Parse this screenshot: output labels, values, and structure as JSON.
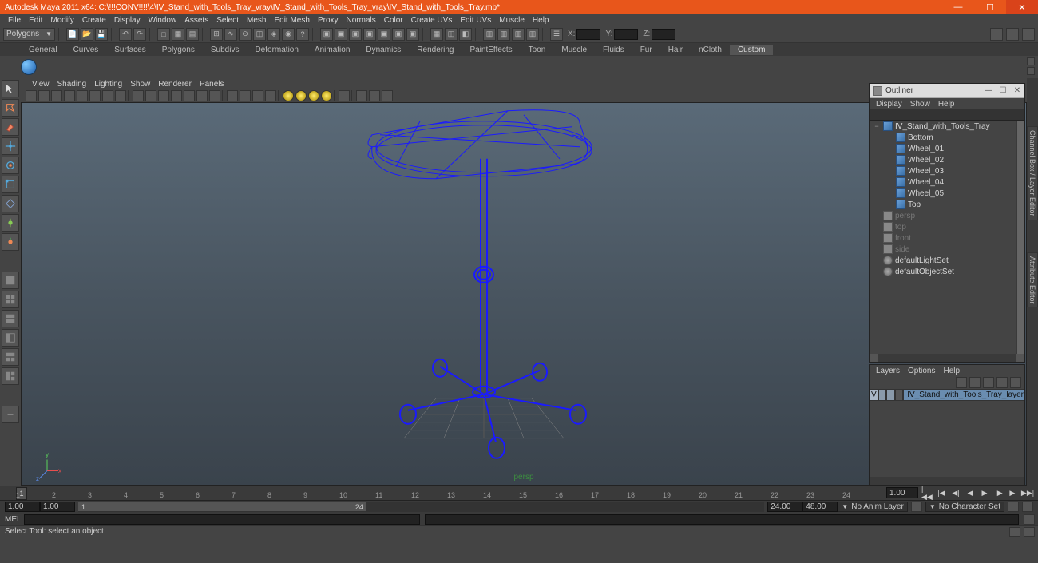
{
  "titlebar": {
    "app": "Autodesk Maya 2011 x64: ",
    "path": "C:\\!!!CONV!!!!\\4\\IV_Stand_with_Tools_Tray_vray\\IV_Stand_with_Tools_Tray_vray\\IV_Stand_with_Tools_Tray.mb*",
    "minimize": "—",
    "maximize": "☐",
    "close": "✕"
  },
  "menubar": [
    "File",
    "Edit",
    "Modify",
    "Create",
    "Display",
    "Window",
    "Assets",
    "Select",
    "Mesh",
    "Edit Mesh",
    "Proxy",
    "Normals",
    "Color",
    "Create UVs",
    "Edit UVs",
    "Muscle",
    "Help"
  ],
  "sel_mode": "Polygons",
  "coords": {
    "x": "X:",
    "y": "Y:",
    "z": "Z:"
  },
  "shelf_tabs": [
    "General",
    "Curves",
    "Surfaces",
    "Polygons",
    "Subdivs",
    "Deformation",
    "Animation",
    "Dynamics",
    "Rendering",
    "PaintEffects",
    "Toon",
    "Muscle",
    "Fluids",
    "Fur",
    "Hair",
    "nCloth",
    "Custom"
  ],
  "shelf_active": "Custom",
  "viewport_menu": [
    "View",
    "Shading",
    "Lighting",
    "Show",
    "Renderer",
    "Panels"
  ],
  "viewport": {
    "persp_label": "persp",
    "axes": {
      "x": "x",
      "y": "y",
      "z": "z"
    }
  },
  "right_tabs": [
    "Channel Box / Layer Editor",
    "Attribute Editor"
  ],
  "outliner": {
    "title": "Outliner",
    "menu": [
      "Display",
      "Show",
      "Help"
    ],
    "win": {
      "min": "—",
      "max": "☐",
      "close": "✕"
    },
    "items": [
      {
        "type": "mesh",
        "label": "IV_Stand_with_Tools_Tray",
        "expand": "−",
        "depth": 0
      },
      {
        "type": "mesh",
        "label": "Bottom",
        "expand": "",
        "depth": 1
      },
      {
        "type": "mesh",
        "label": "Wheel_01",
        "expand": "",
        "depth": 1
      },
      {
        "type": "mesh",
        "label": "Wheel_02",
        "expand": "",
        "depth": 1
      },
      {
        "type": "mesh",
        "label": "Wheel_03",
        "expand": "",
        "depth": 1
      },
      {
        "type": "mesh",
        "label": "Wheel_04",
        "expand": "",
        "depth": 1
      },
      {
        "type": "mesh",
        "label": "Wheel_05",
        "expand": "",
        "depth": 1
      },
      {
        "type": "mesh",
        "label": "Top",
        "expand": "",
        "depth": 1
      },
      {
        "type": "cam",
        "label": "persp",
        "dim": true,
        "depth": 0
      },
      {
        "type": "cam",
        "label": "top",
        "dim": true,
        "depth": 0
      },
      {
        "type": "cam",
        "label": "front",
        "dim": true,
        "depth": 0
      },
      {
        "type": "cam",
        "label": "side",
        "dim": true,
        "depth": 0
      },
      {
        "type": "set",
        "label": "defaultLightSet",
        "depth": 0
      },
      {
        "type": "set",
        "label": "defaultObjectSet",
        "depth": 0
      }
    ]
  },
  "layers": {
    "menu": [
      "Layers",
      "Options",
      "Help"
    ],
    "row": {
      "vis": "V",
      "name": "IV_Stand_with_Tools_Tray_layer"
    }
  },
  "timeline": {
    "current": "1",
    "marks": [
      1,
      2,
      3,
      4,
      5,
      6,
      7,
      8,
      9,
      10,
      11,
      12,
      13,
      14,
      15,
      16,
      17,
      18,
      19,
      20,
      21,
      22,
      23,
      24
    ],
    "frame_box": "1.00"
  },
  "range": {
    "start": "1.00",
    "end": "1.00",
    "in": "1",
    "out": "24",
    "total_start": "24.00",
    "total_end": "48.00",
    "anim_layer": "No Anim Layer",
    "char_set": "No Character Set"
  },
  "cmd": {
    "label": "MEL"
  },
  "help_line": "Select Tool: select an object"
}
